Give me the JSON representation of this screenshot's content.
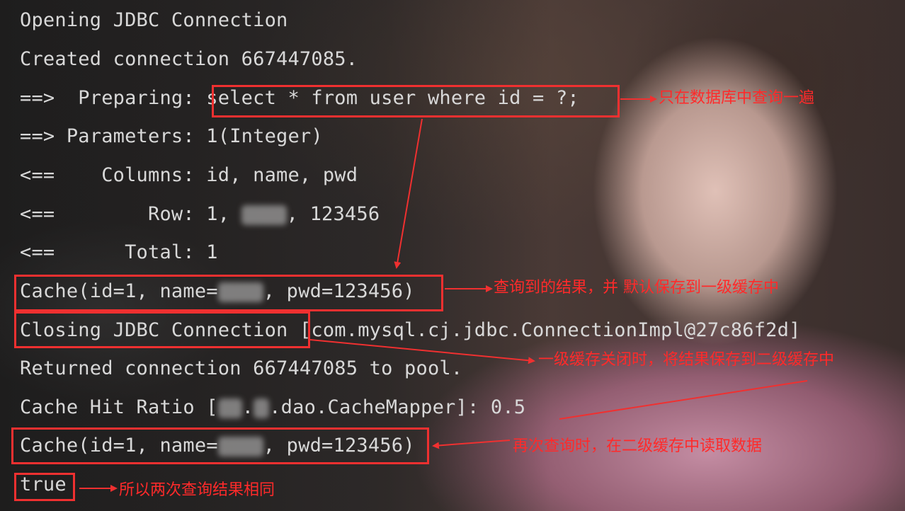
{
  "console": {
    "line1": "Opening JDBC Connection",
    "line2": "Created connection 667447085.",
    "line3_prefix": "==>  Preparing: ",
    "line3_sql": "select * from user where id = ?;",
    "line4": "==> Parameters: 1(Integer)",
    "line5": "<==    Columns: id, name, pwd",
    "line6_prefix": "<==        Row: 1, ",
    "line6_suffix": ", 123456",
    "line7": "<==      Total: 1",
    "line8_prefix": "Cache(id=1, name=",
    "line8_suffix": ", pwd=123456)",
    "line9_boxed": "Closing JDBC Connection",
    "line9_rest": " [com.mysql.cj.jdbc.ConnectionImpl@27c86f2d]",
    "line10": "Returned connection 667447085 to pool.",
    "line11_prefix": "Cache Hit Ratio [",
    "line11_mid": ".",
    "line11_suffix": ".dao.CacheMapper]: 0.5",
    "line12_prefix": "Cache(id=1, name=",
    "line12_suffix": ", pwd=123456)",
    "line13": "true"
  },
  "annotations": {
    "query_once": "只在数据库中查询一遍",
    "result_cached": "查询到的结果，并 默认保存到一级缓存中",
    "close_saves": "一级缓存关闭时，将结果保存到二级缓存中",
    "read_second": "再次查询时，在二级缓存中读取数据",
    "same_result": "所以两次查询结果相同"
  },
  "colors": {
    "annotation": "#ff2a2a",
    "console_text": "#d8d8d8"
  }
}
